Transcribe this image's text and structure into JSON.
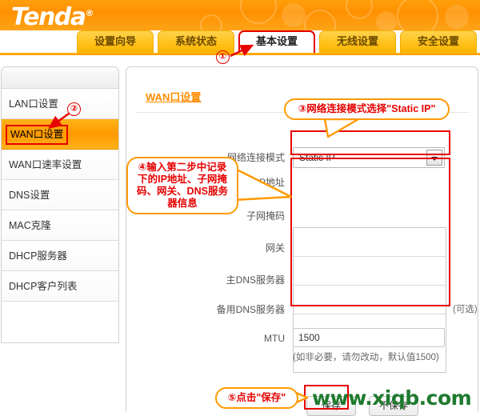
{
  "brand": {
    "name": "Tenda",
    "registered": "®"
  },
  "tabs": [
    {
      "label": "设置向导",
      "active": false
    },
    {
      "label": "系统状态",
      "active": false
    },
    {
      "label": "基本设置",
      "active": true
    },
    {
      "label": "无线设置",
      "active": false
    },
    {
      "label": "安全设置",
      "active": false
    }
  ],
  "sidebar": {
    "items": [
      {
        "label": "LAN口设置",
        "active": false
      },
      {
        "label": "WAN口设置",
        "active": true
      },
      {
        "label": "WAN口速率设置",
        "active": false
      },
      {
        "label": "DNS设置",
        "active": false
      },
      {
        "label": "MAC克隆",
        "active": false
      },
      {
        "label": "DHCP服务器",
        "active": false
      },
      {
        "label": "DHCP客户列表",
        "active": false
      }
    ]
  },
  "panel": {
    "title": "WAN口设置",
    "fields": {
      "conn_mode_label": "网络连接模式",
      "conn_mode_value": "Static IP",
      "ip_label": "IP地址",
      "ip_value": "",
      "mask_label": "子网掩码",
      "mask_value": "",
      "gateway_label": "网关",
      "gateway_value": "",
      "dns1_label": "主DNS服务器",
      "dns1_value": "",
      "dns2_label": "备用DNS服务器",
      "dns2_value": "",
      "dns2_optional": "(可选)",
      "mtu_label": "MTU",
      "mtu_value": "1500",
      "mtu_hint": "(如非必要，请勿改动，默认值1500)"
    },
    "buttons": {
      "save": "保存",
      "cancel": "不保存"
    }
  },
  "callouts": {
    "one": "①",
    "two": "②",
    "three": "③网络连接模式选择\"Static IP\"",
    "four": "④输入第二步中记录下的IP地址、子网掩码、网关、DNS服务器信息",
    "five": "⑤点击\"保存\""
  },
  "watermark": "www.xiqb.com",
  "colors": {
    "brand_orange": "#ff9a00",
    "accent_red": "#e60000",
    "title_orange": "#ff8c00",
    "watermark_green": "#1e7a2e"
  }
}
